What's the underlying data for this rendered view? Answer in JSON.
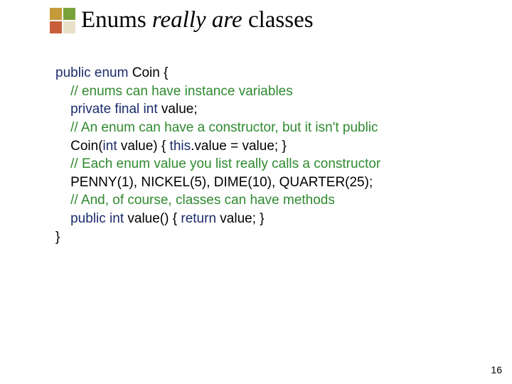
{
  "title": {
    "t1": "Enums ",
    "t2": "really are",
    "t3": " classes"
  },
  "code": {
    "l1a": "public enum",
    "l1b": " Coin {",
    "l2": "    // enums can have instance variables",
    "l3a": "    private final int",
    "l3b": " value;",
    "l4": "    // An enum can have a constructor, but it isn't public",
    "l5a": "    Coin(",
    "l5b": "int",
    "l5c": " value) { ",
    "l5d": "this",
    "l5e": ".value = value; }",
    "l6": "    // Each enum value you list really calls a constructor",
    "l7": "    PENNY(1), NICKEL(5), DIME(10), QUARTER(25);",
    "l8": "    // And, of course, classes can have methods",
    "l9a": "    public int",
    "l9b": " value() { ",
    "l9c": "return",
    "l9d": " value; }",
    "l10": "}"
  },
  "slide_number": "16"
}
